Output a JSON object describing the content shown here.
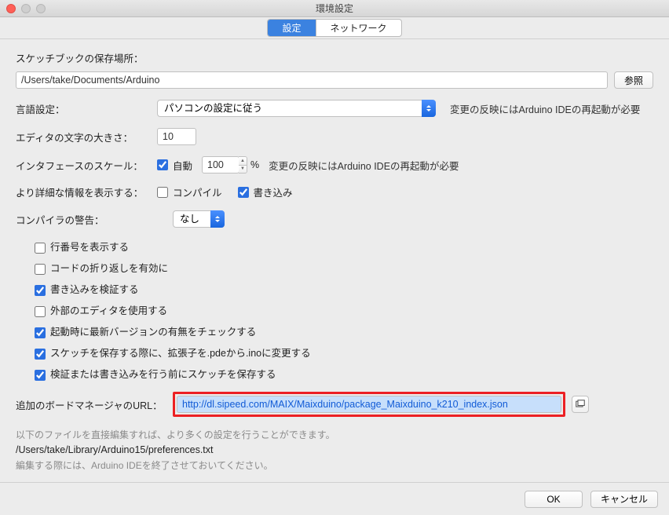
{
  "window": {
    "title": "環境設定"
  },
  "tabs": {
    "settings": "設定",
    "network": "ネットワーク"
  },
  "sketchbook": {
    "label": "スケッチブックの保存場所：",
    "path": "/Users/take/Documents/Arduino",
    "browse": "参照"
  },
  "language": {
    "label": "言語設定：",
    "value": "パソコンの設定に従う",
    "restart_hint": "変更の反映にはArduino IDEの再起動が必要"
  },
  "editor_font": {
    "label": "エディタの文字の大きさ：",
    "value": "10"
  },
  "scale": {
    "label": "インタフェースのスケール：",
    "auto": "自動",
    "value": "100",
    "pct": "%",
    "restart_hint": "変更の反映にはArduino IDEの再起動が必要"
  },
  "verbose": {
    "label": "より詳細な情報を表示する：",
    "compile": "コンパイル",
    "upload": "書き込み"
  },
  "warnings": {
    "label": "コンパイラの警告：",
    "value": "なし"
  },
  "opts": {
    "line_numbers": "行番号を表示する",
    "code_folding": "コードの折り返しを有効に",
    "verify_upload": "書き込みを検証する",
    "external_editor": "外部のエディタを使用する",
    "check_updates": "起動時に最新バージョンの有無をチェックする",
    "update_ext": "スケッチを保存する際に、拡張子を.pdeから.inoに変更する",
    "save_verify": "検証または書き込みを行う前にスケッチを保存する"
  },
  "boards_url": {
    "label": "追加のボードマネージャのURL：",
    "value": "http://dl.sipeed.com/MAIX/Maixduino/package_Maixduino_k210_index.json"
  },
  "more_prefs": {
    "hint": "以下のファイルを直接編集すれば、より多くの設定を行うことができます。",
    "path": "/Users/take/Library/Arduino15/preferences.txt",
    "edit_hint": "編集する際には、Arduino IDEを終了させておいてください。"
  },
  "footer": {
    "ok": "OK",
    "cancel": "キャンセル"
  }
}
